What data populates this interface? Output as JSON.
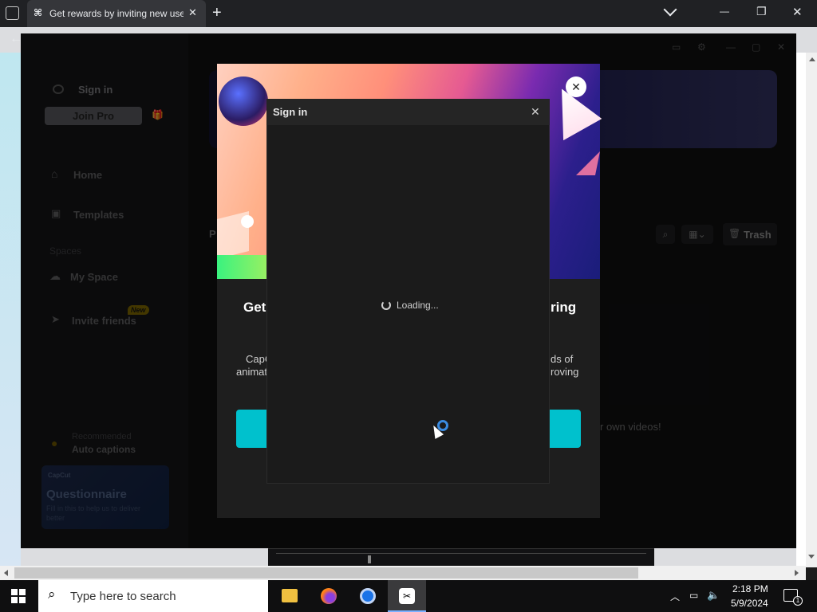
{
  "browser": {
    "tab_title": "Get rewards by inviting new user",
    "new_tab_symbol": "+",
    "close_symbol": "✕",
    "chevron_symbol": "⌄",
    "minimize_symbol": "—",
    "restore_symbol": "❐",
    "back_symbol": "←"
  },
  "capcut": {
    "sign_in_label": "Sign in",
    "join_pro_label": "Join Pro",
    "nav_home": "Home",
    "nav_templates": "Templates",
    "spaces_label": "Spaces",
    "my_space_label": "My Space",
    "invite_friends_label": "Invite friends",
    "new_badge": "New",
    "recommended_label": "Recommended",
    "auto_captions_label": "Auto captions",
    "questionnaire_brand": "CapCut",
    "questionnaire_title": "Questionnaire",
    "questionnaire_text": "Fill in this to help us to deliver better",
    "trash_label": "Trash",
    "partial_p": "P",
    "own_videos_text": "r own videos!"
  },
  "promo": {
    "title_left": "Get",
    "title_right": "ring",
    "text_left_1": "CapC",
    "text_left_2": "animat",
    "text_right_1": "ds of",
    "text_right_2": "roving"
  },
  "signin_dialog": {
    "title": "Sign in",
    "loading_text": "Loading..."
  },
  "taskbar": {
    "search_placeholder": "Type here to search",
    "time": "2:18 PM",
    "date": "5/9/2024",
    "notification_count": "1"
  },
  "colors": {
    "accent_cyan": "#00c1cd",
    "join_pro_bg": "#cfcfd6"
  }
}
